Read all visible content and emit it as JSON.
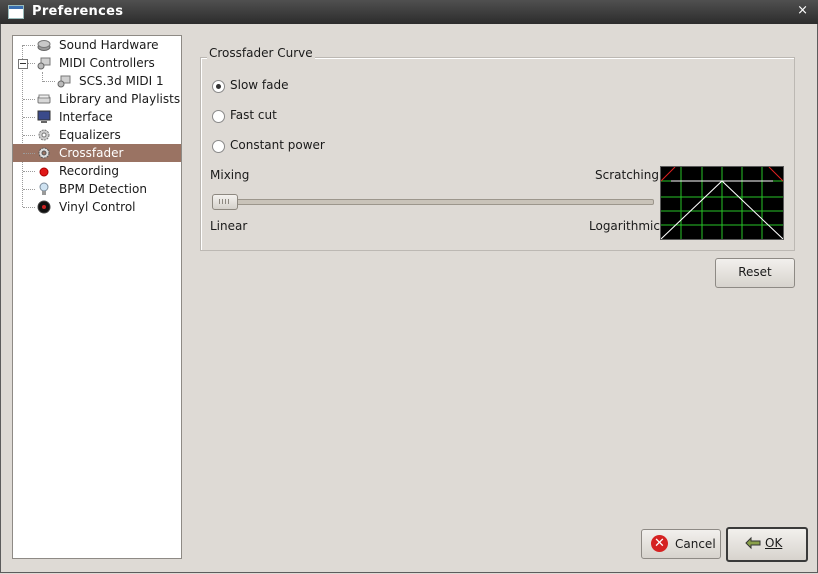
{
  "window": {
    "title": "Preferences",
    "close_glyph": "×"
  },
  "sidebar": {
    "items": [
      {
        "label": "Sound Hardware",
        "icon": "speaker-icon"
      },
      {
        "label": "MIDI Controllers",
        "icon": "midi-controller-icon",
        "expanded": true
      },
      {
        "label": "SCS.3d MIDI 1",
        "icon": "midi-device-icon"
      },
      {
        "label": "Library and Playlists",
        "icon": "library-icon"
      },
      {
        "label": "Interface",
        "icon": "monitor-icon"
      },
      {
        "label": "Equalizers",
        "icon": "equalizer-icon"
      },
      {
        "label": "Crossfader",
        "icon": "crossfader-gear-icon",
        "selected": true
      },
      {
        "label": "Recording",
        "icon": "record-icon"
      },
      {
        "label": "BPM Detection",
        "icon": "bulb-icon"
      },
      {
        "label": "Vinyl Control",
        "icon": "vinyl-icon"
      }
    ],
    "selected_color": "#9a7363"
  },
  "crossfader": {
    "group_title": "Crossfader Curve",
    "options": [
      {
        "label": "Slow fade",
        "checked": true
      },
      {
        "label": "Fast cut",
        "checked": false
      },
      {
        "label": "Constant power",
        "checked": false
      }
    ],
    "mixing_label": "Mixing",
    "scratching_label": "Scratching",
    "linear_label": "Linear",
    "logarithmic_label": "Logarithmic",
    "slider_value": 0,
    "graph_colors": {
      "background": "#000000",
      "grid": "#27c427",
      "curve": "#ffffff",
      "scratch": "#e02020"
    }
  },
  "buttons": {
    "reset": "Reset",
    "cancel": "Cancel",
    "ok": "OK"
  }
}
